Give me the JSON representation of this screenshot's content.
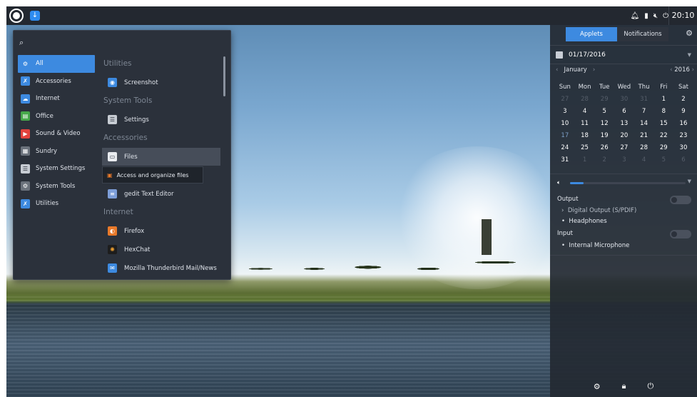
{
  "clock": "20:10",
  "search": {
    "placeholder": ""
  },
  "categories": [
    {
      "label": "All",
      "color": "#3d8ae0",
      "glyph": "⚙"
    },
    {
      "label": "Accessories",
      "color": "#3d8ae0",
      "glyph": "✗"
    },
    {
      "label": "Internet",
      "color": "#3d8ae0",
      "glyph": "☁"
    },
    {
      "label": "Office",
      "color": "#46a84a",
      "glyph": "▤"
    },
    {
      "label": "Sound & Video",
      "color": "#e3433d",
      "glyph": "▶"
    },
    {
      "label": "Sundry",
      "color": "#6b727c",
      "glyph": "▦"
    },
    {
      "label": "System Settings",
      "color": "#c7ccd3",
      "glyph": "☰"
    },
    {
      "label": "System Tools",
      "color": "#6b727c",
      "glyph": "⚙"
    },
    {
      "label": "Utilities",
      "color": "#3d8ae0",
      "glyph": "✗"
    }
  ],
  "sections": {
    "utilities": "Utilities",
    "system_tools": "System Tools",
    "accessories": "Accessories",
    "internet": "Internet"
  },
  "apps": {
    "screenshot": "Screenshot",
    "settings": "Settings",
    "files": "Files",
    "gedit": "gedit Text Editor",
    "firefox": "Firefox",
    "hexchat": "HexChat",
    "thunderbird": "Mozilla Thunderbird Mail/News"
  },
  "tooltip": "Access and organize files",
  "panel": {
    "tab_applets": "Applets",
    "tab_notifications": "Notifications",
    "date": "01/17/2016",
    "month": "January",
    "year": "2016",
    "weekdays": [
      "Sun",
      "Mon",
      "Tue",
      "Wed",
      "Thu",
      "Fri",
      "Sat"
    ],
    "weeks": [
      [
        "27",
        "28",
        "29",
        "30",
        "31",
        "1",
        "2"
      ],
      [
        "3",
        "4",
        "5",
        "6",
        "7",
        "8",
        "9"
      ],
      [
        "10",
        "11",
        "12",
        "13",
        "14",
        "15",
        "16"
      ],
      [
        "17",
        "18",
        "19",
        "20",
        "21",
        "22",
        "23"
      ],
      [
        "24",
        "25",
        "26",
        "27",
        "28",
        "29",
        "30"
      ],
      [
        "31",
        "1",
        "2",
        "3",
        "4",
        "5",
        "6"
      ]
    ],
    "volume_level": 0.12,
    "output_label": "Output",
    "output_options": [
      "Digital Output (S/PDIF)",
      "Headphones"
    ],
    "input_label": "Input",
    "input_options": [
      "Internal Microphone"
    ]
  }
}
